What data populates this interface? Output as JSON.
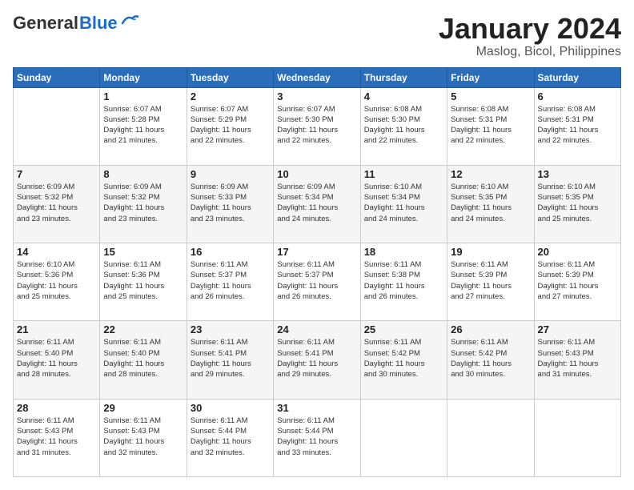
{
  "header": {
    "logo_general": "General",
    "logo_blue": "Blue",
    "title": "January 2024",
    "subtitle": "Maslog, Bicol, Philippines"
  },
  "days_of_week": [
    "Sunday",
    "Monday",
    "Tuesday",
    "Wednesday",
    "Thursday",
    "Friday",
    "Saturday"
  ],
  "weeks": [
    [
      {
        "day": "",
        "info": ""
      },
      {
        "day": "1",
        "info": "Sunrise: 6:07 AM\nSunset: 5:28 PM\nDaylight: 11 hours\nand 21 minutes."
      },
      {
        "day": "2",
        "info": "Sunrise: 6:07 AM\nSunset: 5:29 PM\nDaylight: 11 hours\nand 22 minutes."
      },
      {
        "day": "3",
        "info": "Sunrise: 6:07 AM\nSunset: 5:30 PM\nDaylight: 11 hours\nand 22 minutes."
      },
      {
        "day": "4",
        "info": "Sunrise: 6:08 AM\nSunset: 5:30 PM\nDaylight: 11 hours\nand 22 minutes."
      },
      {
        "day": "5",
        "info": "Sunrise: 6:08 AM\nSunset: 5:31 PM\nDaylight: 11 hours\nand 22 minutes."
      },
      {
        "day": "6",
        "info": "Sunrise: 6:08 AM\nSunset: 5:31 PM\nDaylight: 11 hours\nand 22 minutes."
      }
    ],
    [
      {
        "day": "7",
        "info": "Sunrise: 6:09 AM\nSunset: 5:32 PM\nDaylight: 11 hours\nand 23 minutes."
      },
      {
        "day": "8",
        "info": "Sunrise: 6:09 AM\nSunset: 5:32 PM\nDaylight: 11 hours\nand 23 minutes."
      },
      {
        "day": "9",
        "info": "Sunrise: 6:09 AM\nSunset: 5:33 PM\nDaylight: 11 hours\nand 23 minutes."
      },
      {
        "day": "10",
        "info": "Sunrise: 6:09 AM\nSunset: 5:34 PM\nDaylight: 11 hours\nand 24 minutes."
      },
      {
        "day": "11",
        "info": "Sunrise: 6:10 AM\nSunset: 5:34 PM\nDaylight: 11 hours\nand 24 minutes."
      },
      {
        "day": "12",
        "info": "Sunrise: 6:10 AM\nSunset: 5:35 PM\nDaylight: 11 hours\nand 24 minutes."
      },
      {
        "day": "13",
        "info": "Sunrise: 6:10 AM\nSunset: 5:35 PM\nDaylight: 11 hours\nand 25 minutes."
      }
    ],
    [
      {
        "day": "14",
        "info": "Sunrise: 6:10 AM\nSunset: 5:36 PM\nDaylight: 11 hours\nand 25 minutes."
      },
      {
        "day": "15",
        "info": "Sunrise: 6:11 AM\nSunset: 5:36 PM\nDaylight: 11 hours\nand 25 minutes."
      },
      {
        "day": "16",
        "info": "Sunrise: 6:11 AM\nSunset: 5:37 PM\nDaylight: 11 hours\nand 26 minutes."
      },
      {
        "day": "17",
        "info": "Sunrise: 6:11 AM\nSunset: 5:37 PM\nDaylight: 11 hours\nand 26 minutes."
      },
      {
        "day": "18",
        "info": "Sunrise: 6:11 AM\nSunset: 5:38 PM\nDaylight: 11 hours\nand 26 minutes."
      },
      {
        "day": "19",
        "info": "Sunrise: 6:11 AM\nSunset: 5:39 PM\nDaylight: 11 hours\nand 27 minutes."
      },
      {
        "day": "20",
        "info": "Sunrise: 6:11 AM\nSunset: 5:39 PM\nDaylight: 11 hours\nand 27 minutes."
      }
    ],
    [
      {
        "day": "21",
        "info": "Sunrise: 6:11 AM\nSunset: 5:40 PM\nDaylight: 11 hours\nand 28 minutes."
      },
      {
        "day": "22",
        "info": "Sunrise: 6:11 AM\nSunset: 5:40 PM\nDaylight: 11 hours\nand 28 minutes."
      },
      {
        "day": "23",
        "info": "Sunrise: 6:11 AM\nSunset: 5:41 PM\nDaylight: 11 hours\nand 29 minutes."
      },
      {
        "day": "24",
        "info": "Sunrise: 6:11 AM\nSunset: 5:41 PM\nDaylight: 11 hours\nand 29 minutes."
      },
      {
        "day": "25",
        "info": "Sunrise: 6:11 AM\nSunset: 5:42 PM\nDaylight: 11 hours\nand 30 minutes."
      },
      {
        "day": "26",
        "info": "Sunrise: 6:11 AM\nSunset: 5:42 PM\nDaylight: 11 hours\nand 30 minutes."
      },
      {
        "day": "27",
        "info": "Sunrise: 6:11 AM\nSunset: 5:43 PM\nDaylight: 11 hours\nand 31 minutes."
      }
    ],
    [
      {
        "day": "28",
        "info": "Sunrise: 6:11 AM\nSunset: 5:43 PM\nDaylight: 11 hours\nand 31 minutes."
      },
      {
        "day": "29",
        "info": "Sunrise: 6:11 AM\nSunset: 5:43 PM\nDaylight: 11 hours\nand 32 minutes."
      },
      {
        "day": "30",
        "info": "Sunrise: 6:11 AM\nSunset: 5:44 PM\nDaylight: 11 hours\nand 32 minutes."
      },
      {
        "day": "31",
        "info": "Sunrise: 6:11 AM\nSunset: 5:44 PM\nDaylight: 11 hours\nand 33 minutes."
      },
      {
        "day": "",
        "info": ""
      },
      {
        "day": "",
        "info": ""
      },
      {
        "day": "",
        "info": ""
      }
    ]
  ]
}
